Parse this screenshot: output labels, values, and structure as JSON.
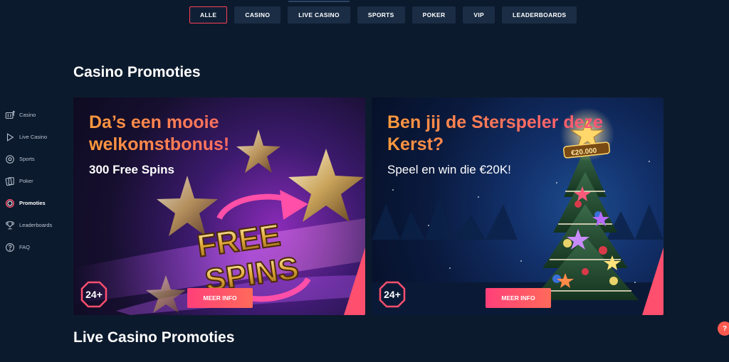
{
  "tabs": [
    {
      "label": "ALLE",
      "active": true
    },
    {
      "label": "CASINO",
      "active": false
    },
    {
      "label": "LIVE CASINO",
      "active": false
    },
    {
      "label": "SPORTS",
      "active": false
    },
    {
      "label": "POKER",
      "active": false
    },
    {
      "label": "VIP",
      "active": false
    },
    {
      "label": "LEADERBOARDS",
      "active": false
    }
  ],
  "sidebar": {
    "items": [
      {
        "label": "Casino",
        "icon": "slot-machine-icon"
      },
      {
        "label": "Live Casino",
        "icon": "play-icon"
      },
      {
        "label": "Sports",
        "icon": "soccer-ball-icon"
      },
      {
        "label": "Poker",
        "icon": "cards-icon"
      },
      {
        "label": "Promoties",
        "icon": "promo-ring-icon",
        "active": true
      },
      {
        "label": "Leaderboards",
        "icon": "trophy-icon"
      },
      {
        "label": "FAQ",
        "icon": "question-icon"
      }
    ]
  },
  "sections": {
    "casino_title": "Casino Promoties",
    "live_title": "Live Casino Promoties"
  },
  "promos": [
    {
      "heading": "Da’s een mooie welkomstbonus!",
      "sub": "300 Free Spins",
      "art_text_1": "FREE",
      "art_text_2": "SPINS",
      "age": "24+",
      "cta": "MEER INFO"
    },
    {
      "heading": "Ben jij de Sterspeler deze Kerst?",
      "sub": "Speel en win die €20K!",
      "art_text_1": "€20.000",
      "age": "24+",
      "cta": "MEER INFO"
    }
  ],
  "help": {
    "label": "?"
  },
  "colors": {
    "background": "#0c1a2d",
    "tab_bg": "#1a2d45",
    "accent": "#ff3f55",
    "cta": "#ff4f7a"
  }
}
